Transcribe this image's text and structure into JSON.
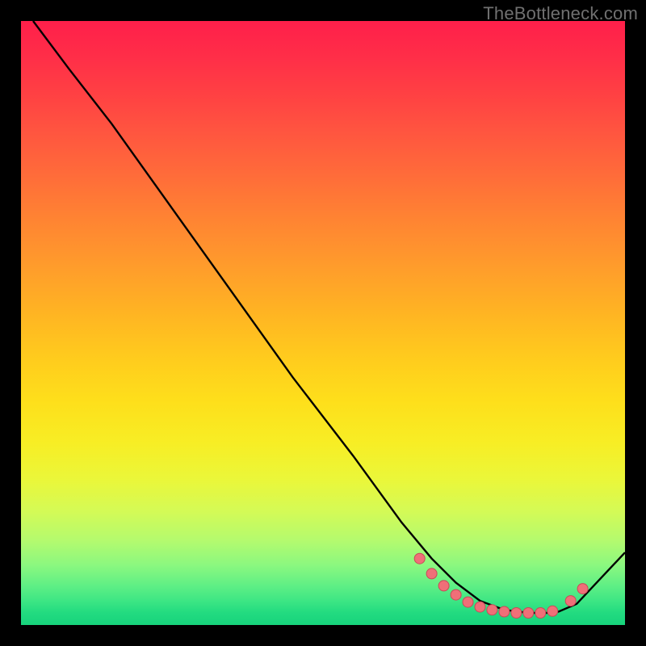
{
  "watermark": "TheBottleneck.com",
  "colors": {
    "frame_bg": "#000000",
    "curve_stroke": "#000000",
    "dot_fill": "#ef6f78",
    "dot_stroke": "#c94a58"
  },
  "chart_data": {
    "type": "line",
    "title": "",
    "xlabel": "",
    "ylabel": "",
    "xlim": [
      0,
      100
    ],
    "ylim": [
      0,
      100
    ],
    "series": [
      {
        "name": "curve",
        "x": [
          2,
          8,
          15,
          25,
          35,
          45,
          55,
          63,
          68,
          72,
          76,
          80,
          84,
          87,
          89,
          92,
          100
        ],
        "y": [
          100,
          92,
          83,
          69,
          55,
          41,
          28,
          17,
          11,
          7,
          4,
          2.5,
          2,
          2,
          2.2,
          3.5,
          12
        ]
      }
    ],
    "highlight_dots": {
      "comment": "coral dots along the valley / rising tail",
      "points": [
        {
          "x": 66,
          "y": 11
        },
        {
          "x": 68,
          "y": 8.5
        },
        {
          "x": 70,
          "y": 6.5
        },
        {
          "x": 72,
          "y": 5
        },
        {
          "x": 74,
          "y": 3.8
        },
        {
          "x": 76,
          "y": 3
        },
        {
          "x": 78,
          "y": 2.5
        },
        {
          "x": 80,
          "y": 2.2
        },
        {
          "x": 82,
          "y": 2
        },
        {
          "x": 84,
          "y": 2
        },
        {
          "x": 86,
          "y": 2
        },
        {
          "x": 88,
          "y": 2.3
        },
        {
          "x": 91,
          "y": 4
        },
        {
          "x": 93,
          "y": 6
        }
      ]
    }
  }
}
